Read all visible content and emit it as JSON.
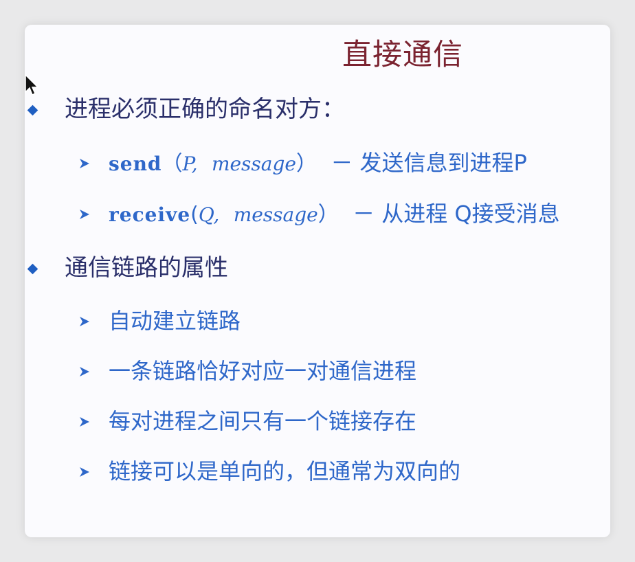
{
  "slide": {
    "title": "直接通信",
    "sections": [
      {
        "bullet": "进程必须正确的命名对方：",
        "items": [
          {
            "func": "send",
            "open": "（",
            "arg1": "P,",
            "arg2": "message",
            "close": "）",
            "desc": "－ 发送信息到进程P"
          },
          {
            "func": "receive",
            "open": "(",
            "arg1": "Q,",
            "arg2": "message",
            "close": "）",
            "desc": "－ 从进程 Q接受消息"
          }
        ]
      },
      {
        "bullet": "通信链路的属性",
        "items": [
          "自动建立链路",
          "一条链路恰好对应一对通信进程",
          "每对进程之间只有一个链接存在",
          "链接可以是单向的，但通常为双向的"
        ]
      }
    ]
  },
  "colors": {
    "title": "#7b2330",
    "bullet_text": "#2a2f6a",
    "sub_text": "#2e67c9",
    "bullet_marker": "#1f5fc2"
  },
  "icons": {
    "bullet": "diamond-bullet-icon",
    "sub_bullet": "arrow-bullet-icon",
    "pointer": "mouse-cursor-icon"
  }
}
